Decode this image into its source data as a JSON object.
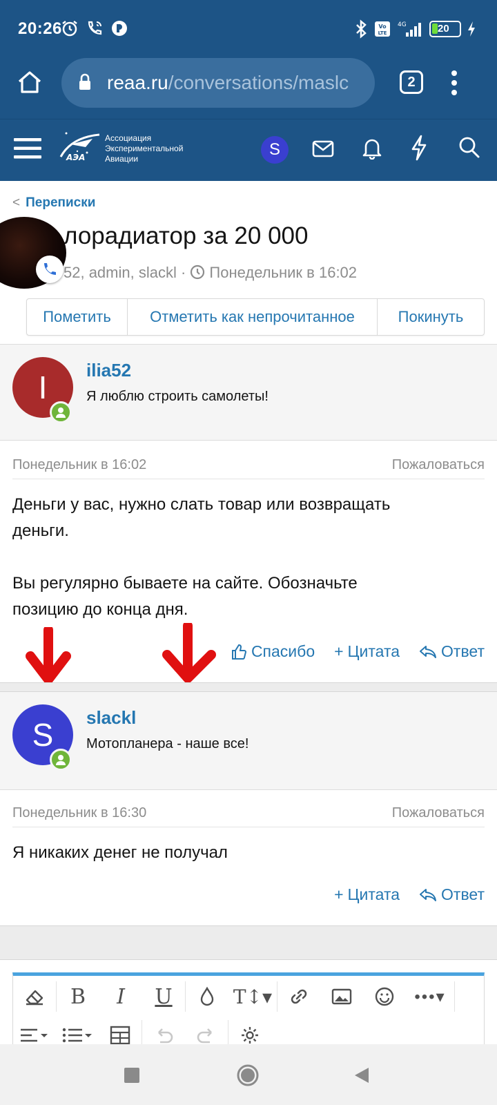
{
  "status_bar": {
    "time": "20:26",
    "battery": "20",
    "network": "4G"
  },
  "browser": {
    "url_domain": "reaa.ru",
    "url_path": "/conversations/maslc",
    "tab_count": "2"
  },
  "site_header": {
    "logo_lines": [
      "Ассоциация",
      "Экспериментальной",
      "Авиации"
    ],
    "logo_abbr": "АЭА",
    "user_initial": "S"
  },
  "conversation": {
    "breadcrumb": "Переписки",
    "title": "лорадиатор за 20 000",
    "meta": "52, admin, slackl · ",
    "meta_time": "Понедельник в 16:02",
    "buttons": {
      "mark": "Пометить",
      "mark_unread": "Отметить как непрочитанное",
      "leave": "Покинуть"
    }
  },
  "messages": [
    {
      "author": "ilia52",
      "author_initial": "I",
      "author_title": "Я люблю строить самолеты!",
      "avatar_color": "#a82b2b",
      "date": "Понедельник в 16:02",
      "report": "Пожаловаться",
      "body_lines": [
        "Деньги у вас, нужно слать товар или возвращать",
        "деньги.",
        "",
        "Вы регулярно бываете на сайте. Обозначьте",
        "позицию до конца дня."
      ],
      "actions": {
        "thanks": "Спасибо",
        "quote": "Цитата",
        "reply": "Ответ"
      }
    },
    {
      "author": "slackl",
      "author_initial": "S",
      "author_title": "Мотопланера - наше все!",
      "avatar_color": "#3a3fd0",
      "date": "Понедельник в 16:30",
      "report": "Пожаловаться",
      "body_lines": [
        "Я никаких денег не получал"
      ],
      "actions": {
        "quote": "Цитата",
        "reply": "Ответ"
      }
    }
  ],
  "colors": {
    "header_blue": "#1d5486",
    "link_blue": "#2577b1",
    "online_green": "#6fb53a",
    "annotation_red": "#e01010"
  }
}
